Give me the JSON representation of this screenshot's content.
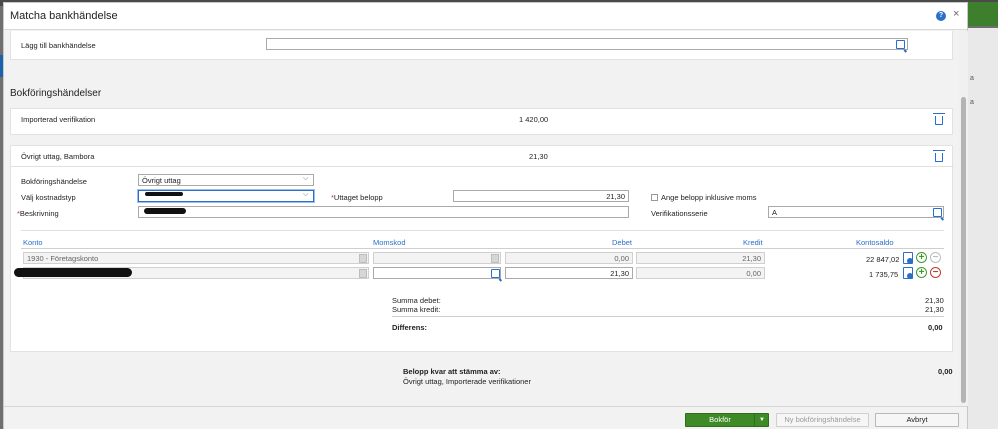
{
  "dialog": {
    "title": "Matcha bankhändelse",
    "help": "?",
    "close": "×"
  },
  "add_bank_event": {
    "label": "Lägg till bankhändelse",
    "value": ""
  },
  "section_title": "Bokföringshändelser",
  "imported": {
    "label": "Importerad verifikation",
    "amount": "1 420,00"
  },
  "entry": {
    "header": "Övrigt uttag, Bambora",
    "amount": "21,30",
    "event_type_label": "Bokföringshändelse",
    "event_type_value": "Övrigt uttag",
    "cost_type_label": "Välj kostnadstyp",
    "withdrawn_label": "Uttaget belopp",
    "withdrawn_value": "21,30",
    "incl_vat_label": "Ange belopp inklusive moms",
    "description_label": "Beskrivning",
    "series_label": "Verifikationsserie",
    "series_value": "A"
  },
  "table": {
    "headers": {
      "konto": "Konto",
      "momskod": "Momskod",
      "debet": "Debet",
      "kredit": "Kredit",
      "kontosaldo": "Kontosaldo"
    },
    "rows": [
      {
        "konto": "1930 - Företagskonto",
        "momskod": "",
        "debet": "0,00",
        "kredit": "21,30",
        "saldo": "22 847,02"
      },
      {
        "konto": "",
        "momskod": "",
        "debet": "21,30",
        "kredit": "0,00",
        "saldo": "1 735,75"
      }
    ]
  },
  "summary": {
    "debet_label": "Summa debet:",
    "debet_value": "21,30",
    "kredit_label": "Summa kredit:",
    "kredit_value": "21,30",
    "diff_label": "Differens:",
    "diff_value": "0,00"
  },
  "remaining": {
    "label": "Belopp kvar att stämma av:",
    "sub": "Övrigt uttag, Importerade verifikationer",
    "value": "0,00"
  },
  "footer": {
    "book": "Bokför",
    "new_event": "Ny bokföringshändelse",
    "cancel": "Avbryt"
  },
  "background": {
    "side_a": "a",
    "side_b": "a"
  },
  "colors": {
    "accent": "#2a6fc9",
    "primary_button": "#3e8a27",
    "required": "#c0392b"
  }
}
